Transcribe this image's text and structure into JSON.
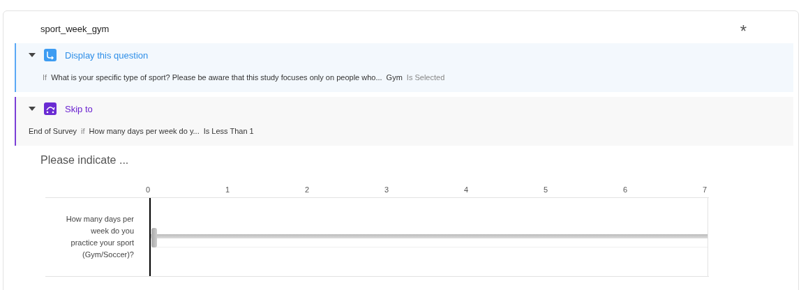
{
  "question": {
    "id_label": "sport_week_gym",
    "required_mark": "*"
  },
  "display_logic": {
    "title": "Display this question",
    "expanded": true,
    "parts": [
      {
        "kind": "keyword",
        "text": "If"
      },
      {
        "kind": "value",
        "text": "What is your specific type of sport?  Please be aware that this study focuses only on people who..."
      },
      {
        "kind": "value",
        "text": "Gym"
      },
      {
        "kind": "keyword",
        "text": "Is Selected"
      }
    ]
  },
  "skip_logic": {
    "title": "Skip to",
    "expanded": true,
    "parts": [
      {
        "kind": "value",
        "text": "End of Survey"
      },
      {
        "kind": "keyword",
        "text": "if"
      },
      {
        "kind": "value",
        "text": "How many days per week do y..."
      },
      {
        "kind": "value",
        "text": "Is Less Than 1"
      }
    ]
  },
  "prompt": "Please indicate ...",
  "scale_labels": [
    "0",
    "1",
    "2",
    "3",
    "4",
    "5",
    "6",
    "7"
  ],
  "sliders": [
    {
      "label": "How many days per week do you practice your sport (Gym/Soccer)?",
      "level": 0
    }
  ]
}
